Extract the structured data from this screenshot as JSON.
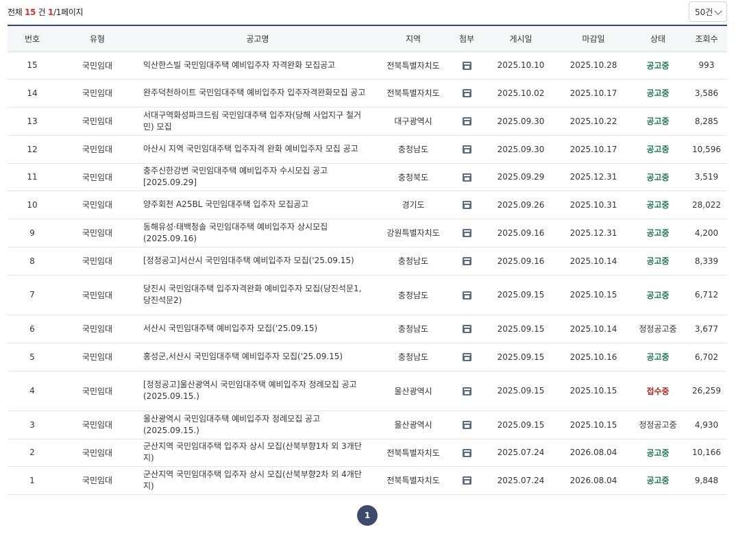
{
  "summary": {
    "prefix": "전체",
    "total": "15",
    "unit": "건",
    "current_page": "1",
    "page_suffix": "/1페이지"
  },
  "page_size": {
    "selected": "50건"
  },
  "columns": [
    "번호",
    "유형",
    "공고명",
    "지역",
    "첨부",
    "게시일",
    "마감일",
    "상태",
    "조회수"
  ],
  "rows": [
    {
      "no": "15",
      "type": "국민임대",
      "title": "익산한스빌 국민임대주택 예비입주자 자격완화 모집공고",
      "region": "전북특별자치도",
      "posted": "2025.10.10",
      "deadline": "2025.10.28",
      "status": "공고중",
      "views": "993",
      "status_kind": "open",
      "h": 40
    },
    {
      "no": "14",
      "type": "국민임대",
      "title": "완주덕천하이트 국민임대주택 예비입주자 입주자격완화모집 공고",
      "region": "전북특별자치도",
      "posted": "2025.10.02",
      "deadline": "2025.10.17",
      "status": "공고중",
      "views": "3,586",
      "status_kind": "open",
      "h": 41
    },
    {
      "no": "13",
      "type": "국민임대",
      "title": "서대구역화성파크드림 국민임대주택 입주자(당해 사업지구 철거민) 모집",
      "region": "대구광역시",
      "posted": "2025.09.30",
      "deadline": "2025.10.22",
      "status": "공고중",
      "views": "8,285",
      "status_kind": "open",
      "h": 41
    },
    {
      "no": "12",
      "type": "국민임대",
      "title": "아산시 지역 국민임대주택 입주자격 완화 예비입주자 모집 공고",
      "region": "충청남도",
      "posted": "2025.09.30",
      "deadline": "2025.10.17",
      "status": "공고중",
      "views": "10,596",
      "status_kind": "open",
      "h": 41
    },
    {
      "no": "11",
      "type": "국민임대",
      "title": "충주신한강변 국민임대주택 예비입주자 수시모집 공고[2025.09.29]",
      "region": "충청북도",
      "posted": "2025.09.29",
      "deadline": "2025.12.31",
      "status": "공고중",
      "views": "3,519",
      "status_kind": "open",
      "h": 40
    },
    {
      "no": "10",
      "type": "국민임대",
      "title": "양주회천 A25BL 국민임대주택 입주자 모집공고",
      "region": "경기도",
      "posted": "2025.09.26",
      "deadline": "2025.10.31",
      "status": "공고중",
      "views": "28,022",
      "status_kind": "open",
      "h": 41
    },
    {
      "no": "9",
      "type": "국민임대",
      "title": "동해유성·태백청솔 국민임대주택 예비입주자 상시모집(2025.09.16)",
      "region": "강원특별자치도",
      "posted": "2025.09.16",
      "deadline": "2025.12.31",
      "status": "공고중",
      "views": "4,200",
      "status_kind": "open",
      "h": 41
    },
    {
      "no": "8",
      "type": "국민임대",
      "title": "[정정공고]서산시 국민임대주택 예비입주자 모집('25.09.15)",
      "region": "충청남도",
      "posted": "2025.09.16",
      "deadline": "2025.10.14",
      "status": "공고중",
      "views": "8,339",
      "status_kind": "open",
      "h": 41
    },
    {
      "no": "7",
      "type": "국민임대",
      "title": "당진시 국민임대주택 입주자격완화 예비입주자 모집(당진석문1, 당진석문2)",
      "region": "충청남도",
      "posted": "2025.09.15",
      "deadline": "2025.10.15",
      "status": "공고중",
      "views": "6,712",
      "status_kind": "open",
      "h": 58
    },
    {
      "no": "6",
      "type": "국민임대",
      "title": "서산시 국민임대주택 예비입주자 모집('25.09.15)",
      "region": "충청남도",
      "posted": "2025.09.15",
      "deadline": "2025.10.14",
      "status": "정정공고중",
      "views": "3,677",
      "status_kind": "corr",
      "h": 41
    },
    {
      "no": "5",
      "type": "국민임대",
      "title": "홍성군,서산시 국민임대주택 예비입주자 모집('25.09.15)",
      "region": "충청남도",
      "posted": "2025.09.15",
      "deadline": "2025.10.16",
      "status": "공고중",
      "views": "6,702",
      "status_kind": "open",
      "h": 41
    },
    {
      "no": "4",
      "type": "국민임대",
      "title": "[정정공고]울산광역시 국민임대주택 예비입주자 정례모집 공고 (2025.09.15.)",
      "region": "울산광역시",
      "posted": "2025.09.15",
      "deadline": "2025.10.15",
      "status": "접수중",
      "views": "26,259",
      "status_kind": "closed",
      "h": 58
    },
    {
      "no": "3",
      "type": "국민임대",
      "title": "울산광역시 국민임대주택 예비입주자 정례모집 공고(2025.09.15.)",
      "region": "울산광역시",
      "posted": "2025.09.15",
      "deadline": "2025.10.15",
      "status": "정정공고중",
      "views": "4,930",
      "status_kind": "corr",
      "h": 41
    },
    {
      "no": "2",
      "type": "국민임대",
      "title": "군산지역 국민임대주택 입주자 상시 모집(산북부향1차 외 3개단지)",
      "region": "전북특별자치도",
      "posted": "2025.07.24",
      "deadline": "2026.08.04",
      "status": "공고중",
      "views": "10,166",
      "status_kind": "open",
      "h": 40
    },
    {
      "no": "1",
      "type": "국민임대",
      "title": "군산지역 국민임대주택 입주자 상시 모집(산북부향2차 외 4개단지)",
      "region": "전북특별자치도",
      "posted": "2025.07.24",
      "deadline": "2026.08.04",
      "status": "공고중",
      "views": "9,848",
      "status_kind": "open",
      "h": 41
    }
  ],
  "pagination": {
    "current": "1"
  }
}
